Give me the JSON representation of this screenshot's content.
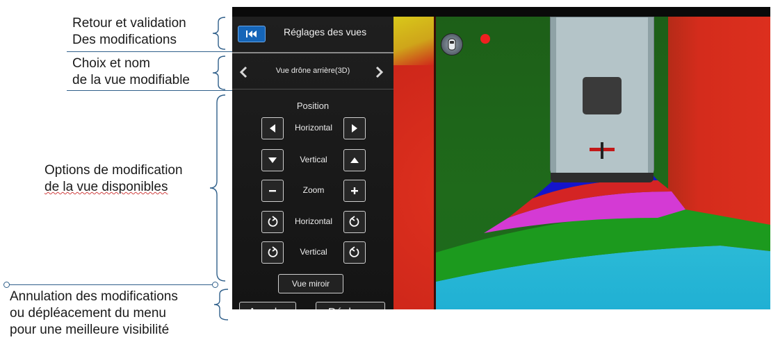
{
  "annotations": [
    {
      "lines": [
        "Retour et validation",
        "Des modifications"
      ]
    },
    {
      "lines": [
        "Choix et nom",
        "de la vue modifiable"
      ]
    },
    {
      "lines": [
        "Options de modification",
        "de la vue disponibles"
      ]
    },
    {
      "lines": [
        "Annulation des modifications",
        "ou dépléacement du menu",
        "pour une meilleure visibilité"
      ]
    }
  ],
  "menu": {
    "title": "Réglages des vues",
    "back_icon": "skip-back-icon",
    "view_name": "Vue drône arrière(3D)",
    "section_title": "Position",
    "controls": [
      {
        "label": "Horizontal",
        "left_icon": "arrow-left-icon",
        "right_icon": "arrow-right-icon"
      },
      {
        "label": "Vertical",
        "left_icon": "arrow-down-icon",
        "right_icon": "arrow-up-icon"
      },
      {
        "label": "Zoom",
        "left_icon": "minus-icon",
        "right_icon": "plus-icon"
      },
      {
        "label": "Horizontal",
        "left_icon": "rotate-ccw-icon",
        "right_icon": "rotate-cw-icon"
      },
      {
        "label": "Vertical",
        "left_icon": "rotate-ccw-icon",
        "right_icon": "rotate-cw-icon"
      }
    ],
    "mirror_label": "Vue miroir",
    "cancel_label": "Annuler",
    "move_label": "Déplacer"
  },
  "colors": {
    "accent": "#1565b8",
    "zone_red": "#d62a1c",
    "zone_green": "#1e6b1a",
    "zone_blue": "#1818d0",
    "zone_pink": "#d838d8",
    "zone_cyan": "#22b8d8",
    "zone_yellow": "#d8c81a"
  }
}
